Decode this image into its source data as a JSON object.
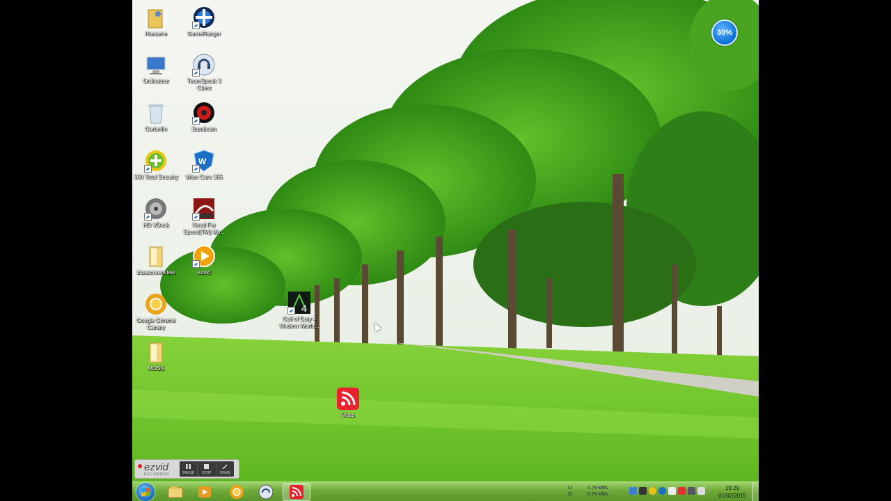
{
  "desktop": {
    "icons": [
      {
        "label": "Hassene",
        "icon": "folder-user-icon"
      },
      {
        "label": "GameRanger",
        "icon": "gameranger-icon"
      },
      {
        "label": "Ordinateur",
        "icon": "computer-icon"
      },
      {
        "label": "TeamSpeak 3 Client",
        "icon": "teamspeak-icon"
      },
      {
        "label": "Corbeille",
        "icon": "recycle-bin-icon"
      },
      {
        "label": "Bandicam",
        "icon": "bandicam-icon"
      },
      {
        "label": "360 Total Security",
        "icon": "360-total-security-icon"
      },
      {
        "label": "Wise Care 365",
        "icon": "wise-care-icon"
      },
      {
        "label": "HD VDeck",
        "icon": "hd-vdeck-icon"
      },
      {
        "label": "Need For Speed(TM) Mo...",
        "icon": "need-for-speed-icon"
      },
      {
        "label": "bluescreenview",
        "icon": "folder-icon"
      },
      {
        "label": "ezvid",
        "icon": "ezvid-icon"
      },
      {
        "label": "Google Chrome Canary",
        "icon": "chrome-canary-icon"
      },
      {
        "label": "Call of Duty 4 Modern Warfa...",
        "icon": "call-of-duty-icon"
      },
      {
        "label": "MOSS",
        "icon": "folder-icon"
      },
      {
        "label": "Moss",
        "icon": "rss-feed-icon"
      }
    ],
    "progress_badge": "30%"
  },
  "ezvid_recorder": {
    "logo": "ezvid",
    "sub": "RECORDER",
    "pause": "PAUSE",
    "stop": "STOP",
    "draw": "DRAW"
  },
  "taskbar": {
    "apps": [
      "explorer-icon",
      "media-player-icon",
      "chrome-canary-icon",
      "teamspeak-icon",
      "rss-feed-icon"
    ],
    "net_upload_label": "U:",
    "net_upload": "0.79 kB/s",
    "net_download_label": "D:",
    "net_download": "0.78 kB/s",
    "time": "19:29",
    "date": "01/02/2015"
  },
  "colors": {
    "taskbar": "#7ab848",
    "accent": "#0b6fd6",
    "rss": "#e8232f"
  }
}
